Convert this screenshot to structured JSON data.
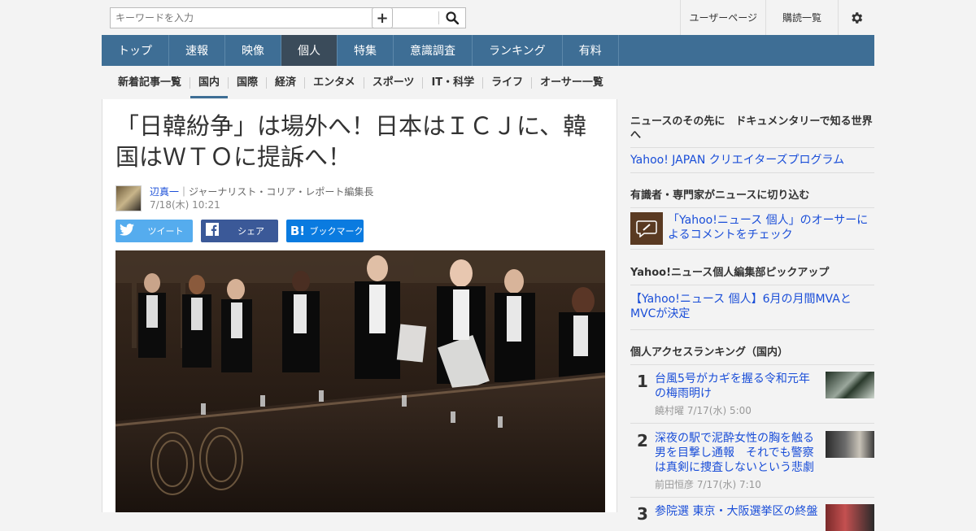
{
  "search": {
    "placeholder": "キーワードを入力"
  },
  "toplinks": {
    "user_page": "ユーザーページ",
    "subscriptions": "購読一覧"
  },
  "nav": [
    "トップ",
    "速報",
    "映像",
    "個人",
    "特集",
    "意識調査",
    "ランキング",
    "有料"
  ],
  "nav_active": "個人",
  "subnav": [
    "新着記事一覧",
    "国内",
    "国際",
    "経済",
    "エンタメ",
    "スポーツ",
    "IT・科学",
    "ライフ",
    "オーサー一覧"
  ],
  "subnav_active": "国内",
  "article": {
    "title": "「日韓紛争」は場外へ！日本はＩＣＪに、韓国はＷＴＯに提訴へ！",
    "author_name": "辺真一",
    "author_role": "｜ジャーナリスト・コリア・レポート編集長",
    "date": "7/18(木) 10:21",
    "share_tweet": "ツイート",
    "share_facebook": "シェア",
    "share_hatena": "ブックマーク",
    "photo_caption_alt": "ICJ judges"
  },
  "sidebar": {
    "sec1_title": "ニュースのその先に　ドキュメンタリーで知る世界へ",
    "sec1_link": "Yahoo! JAPAN クリエイターズプログラム",
    "sec2_title": "有識者・専門家がニュースに切り込む",
    "sec2_link": "「Yahoo!ニュース 個人」のオーサーによるコメントをチェック",
    "sec3_title": "Yahoo!ニュース個人編集部ピックアップ",
    "sec3_link": "【Yahoo!ニュース 個人】6月の月間MVAとMVCが決定",
    "sec4_title": "個人アクセスランキング（国内）",
    "ranking": [
      {
        "num": "1",
        "title": "台風5号がカギを握る令和元年の梅雨明け",
        "meta": "饒村曜  7/17(水) 5:00"
      },
      {
        "num": "2",
        "title": "深夜の駅で泥酔女性の胸を触る男を目撃し通報　それでも警察は真剣に捜査しないという悲劇",
        "meta": "前田恒彦  7/17(水) 7:10"
      },
      {
        "num": "3",
        "title": "参院選 東京・大阪選挙区の終盤",
        "meta": ""
      }
    ]
  }
}
